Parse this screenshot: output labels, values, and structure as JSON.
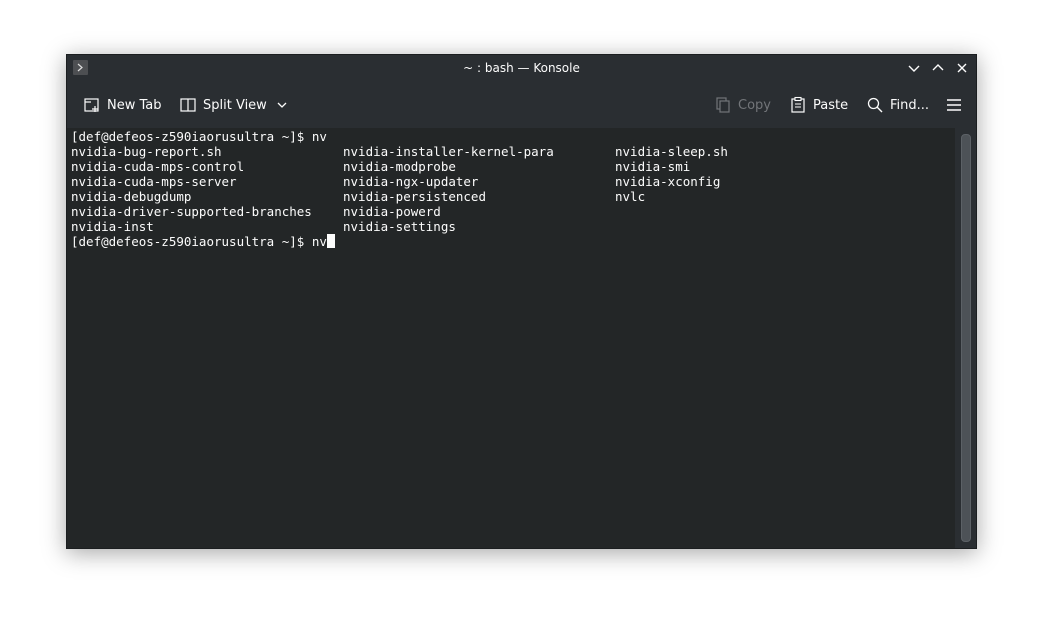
{
  "window": {
    "title": "~ : bash — Konsole"
  },
  "toolbar": {
    "new_tab": "New Tab",
    "split_view": "Split View",
    "copy": "Copy",
    "paste": "Paste",
    "find": "Find..."
  },
  "terminal": {
    "prompt_line_1": "[def@defeos-z590iaorusultra ~]$ nv",
    "completions": [
      [
        "nvidia-bug-report.sh",
        "nvidia-installer-kernel-para",
        "nvidia-sleep.sh"
      ],
      [
        "nvidia-cuda-mps-control",
        "nvidia-modprobe",
        "nvidia-smi"
      ],
      [
        "nvidia-cuda-mps-server",
        "nvidia-ngx-updater",
        "nvidia-xconfig"
      ],
      [
        "nvidia-debugdump",
        "nvidia-persistenced",
        "nvlc"
      ],
      [
        "nvidia-driver-supported-branches",
        "nvidia-powerd",
        ""
      ],
      [
        "nvidia-inst",
        "nvidia-settings",
        ""
      ]
    ],
    "prompt_line_2": "[def@defeos-z590iaorusultra ~]$ nv"
  },
  "colors": {
    "window_bg": "#2a2e32",
    "terminal_bg": "#232627",
    "text": "#fcfcfc",
    "disabled_text": "#727579"
  }
}
